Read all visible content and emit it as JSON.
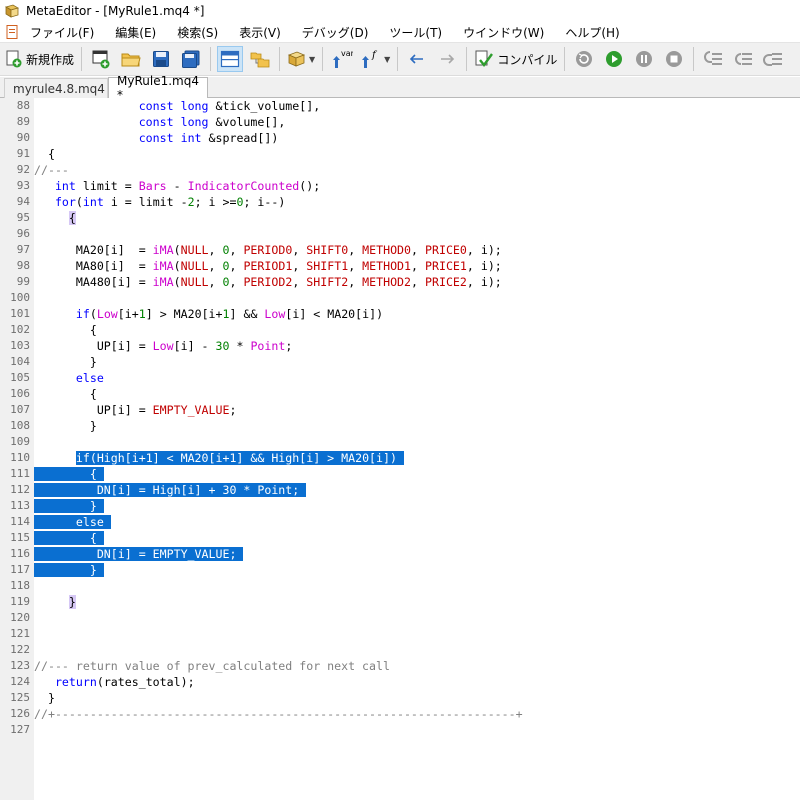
{
  "window": {
    "title": "MetaEditor - [MyRule1.mq4 *]"
  },
  "menu": {
    "items": [
      "ファイル(F)",
      "編集(E)",
      "検索(S)",
      "表示(V)",
      "デバッグ(D)",
      "ツール(T)",
      "ウインドウ(W)",
      "ヘルプ(H)"
    ]
  },
  "toolbar": {
    "new_label": "新規作成",
    "compile_label": "コンパイル",
    "var_label": "var",
    "func_label": "f"
  },
  "tabs": [
    {
      "label": "myrule4.8.mq4",
      "active": false
    },
    {
      "label": "MyRule1.mq4 *",
      "active": true
    }
  ],
  "editor": {
    "lines": [
      {
        "n": "88",
        "text": "               const long &tick_volume[],"
      },
      {
        "n": "89",
        "text": "               const long &volume[],"
      },
      {
        "n": "90",
        "text": "               const int &spread[])"
      },
      {
        "n": "91",
        "text": "  {"
      },
      {
        "n": "92",
        "text": "//---"
      },
      {
        "n": "93",
        "text": "   int limit = Bars - IndicatorCounted();"
      },
      {
        "n": "94",
        "text": "   for(int i = limit -2; i >=0; i--)"
      },
      {
        "n": "95",
        "text": "     {"
      },
      {
        "n": "96",
        "text": ""
      },
      {
        "n": "97",
        "text": "      MA20[i]  = iMA(NULL, 0, PERIOD0, SHIFT0, METHOD0, PRICE0, i);"
      },
      {
        "n": "98",
        "text": "      MA80[i]  = iMA(NULL, 0, PERIOD1, SHIFT1, METHOD1, PRICE1, i);"
      },
      {
        "n": "99",
        "text": "      MA480[i] = iMA(NULL, 0, PERIOD2, SHIFT2, METHOD2, PRICE2, i);"
      },
      {
        "n": "100",
        "text": ""
      },
      {
        "n": "101",
        "text": "      if(Low[i+1] > MA20[i+1] && Low[i] < MA20[i])"
      },
      {
        "n": "102",
        "text": "        {"
      },
      {
        "n": "103",
        "text": "         UP[i] = Low[i] - 30 * Point;"
      },
      {
        "n": "104",
        "text": "        }"
      },
      {
        "n": "105",
        "text": "      else"
      },
      {
        "n": "106",
        "text": "        {"
      },
      {
        "n": "107",
        "text": "         UP[i] = EMPTY_VALUE;"
      },
      {
        "n": "108",
        "text": "        }"
      },
      {
        "n": "109",
        "text": ""
      },
      {
        "n": "110",
        "text": "      if(High[i+1] < MA20[i+1] && High[i] > MA20[i])"
      },
      {
        "n": "111",
        "text": "        {"
      },
      {
        "n": "112",
        "text": "         DN[i] = High[i] + 30 * Point;"
      },
      {
        "n": "113",
        "text": "        }"
      },
      {
        "n": "114",
        "text": "      else"
      },
      {
        "n": "115",
        "text": "        {"
      },
      {
        "n": "116",
        "text": "         DN[i] = EMPTY_VALUE;"
      },
      {
        "n": "117",
        "text": "        }"
      },
      {
        "n": "118",
        "text": ""
      },
      {
        "n": "119",
        "text": "     }"
      },
      {
        "n": "120",
        "text": ""
      },
      {
        "n": "121",
        "text": ""
      },
      {
        "n": "122",
        "text": ""
      },
      {
        "n": "123",
        "text": "//--- return value of prev_calculated for next call"
      },
      {
        "n": "124",
        "text": "   return(rates_total);"
      },
      {
        "n": "125",
        "text": "  }"
      },
      {
        "n": "126",
        "text": "//+------------------------------------------------------------------+"
      },
      {
        "n": "127",
        "text": ""
      }
    ],
    "selected_lines": [
      "110",
      "111",
      "112",
      "113",
      "114",
      "115",
      "116",
      "117"
    ]
  },
  "colors": {
    "selection": "#0a6fd1",
    "keyword": "#0000ff",
    "builtin": "#cc00cc",
    "constant": "#c00000",
    "number": "#008000",
    "comment": "#808080",
    "gutter": "#f0f0f0"
  }
}
